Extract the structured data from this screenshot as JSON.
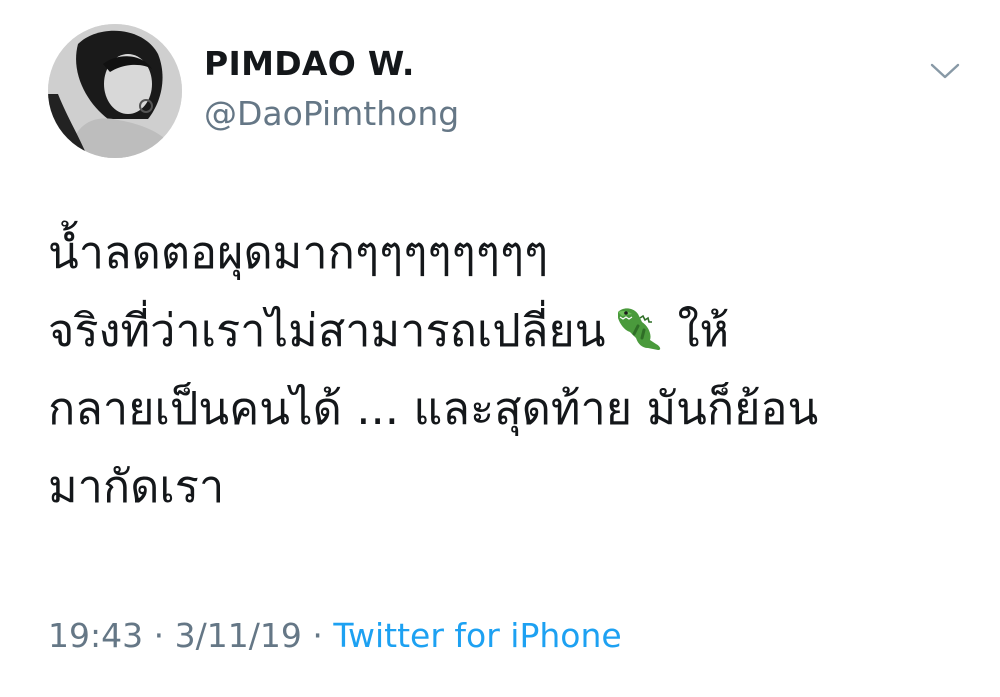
{
  "user": {
    "display_name": "PIMDAO W.",
    "handle": "@DaoPimthong"
  },
  "tweet": {
    "line1": "น้ำลดตอผุดมากๆๆๆๆๆๆๆๆ",
    "line2_before_emoji": "จริงที่ว่าเราไม่สามารถเปลี่ยน",
    "emoji": "crocodile-emoji",
    "line2_after_emoji": "ให้",
    "line3": "กลายเป็นคนได้ ... และสุดท้าย มันก็ย้อน",
    "line4": "มากัดเรา"
  },
  "meta": {
    "time": "19:43",
    "separator": "·",
    "date": "3/11/19",
    "source": "Twitter for iPhone"
  },
  "icons": {
    "menu": "chevron-down-icon"
  },
  "colors": {
    "text": "#14171a",
    "secondary": "#657786",
    "link": "#1da1f2",
    "emoji_green": "#4a9a3c"
  }
}
